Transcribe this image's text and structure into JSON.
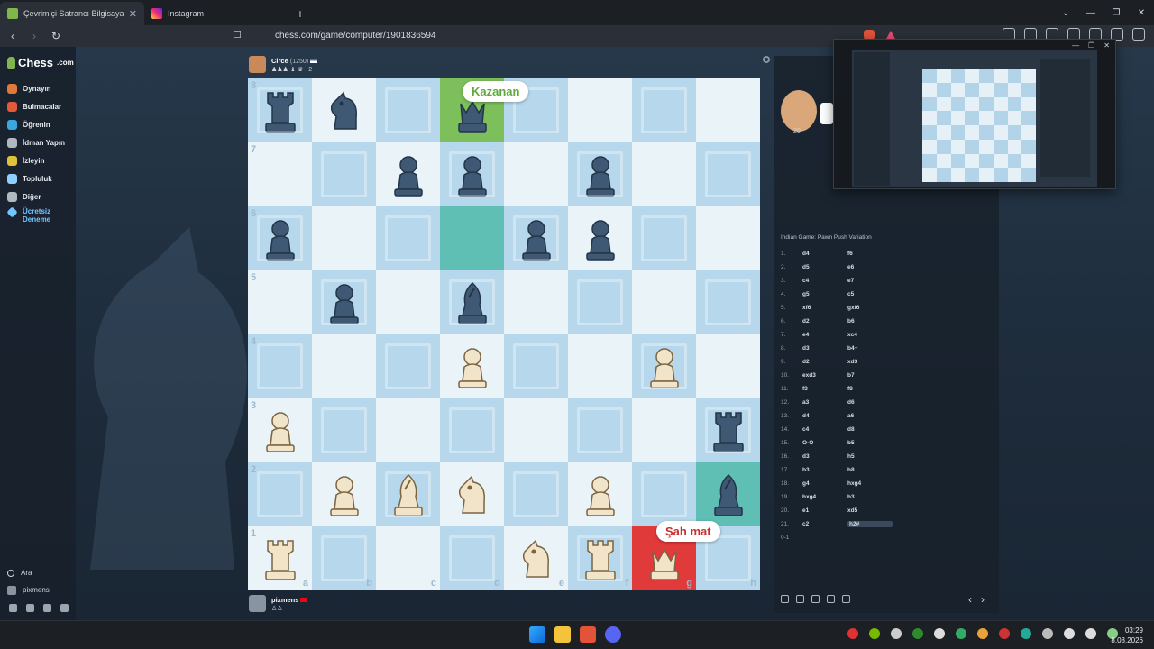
{
  "browser": {
    "tabs": [
      {
        "title": "Çevrimiçi Satrancı Bilgisayara",
        "close": "✕",
        "active": true,
        "favicon_color": "#81b64c"
      },
      {
        "title": "Instagram",
        "active": false,
        "favicon_color": "#e1306c"
      }
    ],
    "new_tab": "+",
    "window_controls": [
      "⌄",
      "—",
      "❐",
      "✕"
    ],
    "url": "chess.com/game/computer/1901836594",
    "nav": {
      "back": "‹",
      "forward": "›",
      "reload": "↻",
      "bookmark": "☐"
    }
  },
  "sidebar": {
    "logo": "Chess",
    "logo_suffix": ".com",
    "items": [
      {
        "label": "Oynayın",
        "icon": "play-icon",
        "color": "#e07a3a"
      },
      {
        "label": "Bulmacalar",
        "icon": "puzzle-icon",
        "color": "#e25a3a"
      },
      {
        "label": "Öğrenin",
        "icon": "learn-icon",
        "color": "#3aa8e0"
      },
      {
        "label": "İdman Yapın",
        "icon": "train-icon",
        "color": "#b0b8c0"
      },
      {
        "label": "İzleyin",
        "icon": "watch-icon",
        "color": "#e0c23a"
      },
      {
        "label": "Topluluk",
        "icon": "community-icon",
        "color": "#8fd0ff"
      },
      {
        "label": "Diğer",
        "icon": "more-icon",
        "color": "#b0b8c0"
      }
    ],
    "free_trial": "Ücretsiz Deneme",
    "search": "Ara",
    "user": "pixmens"
  },
  "players": {
    "top": {
      "name": "Circe",
      "rating": "(1250)",
      "captured": "♟♟♟ ♝ ♛ +2"
    },
    "bottom": {
      "name": "pixmens",
      "captured": "♙♙"
    }
  },
  "board": {
    "badges": {
      "winner": "Kazanan",
      "mate": "Şah mat"
    },
    "ranks": [
      "8",
      "7",
      "6",
      "5",
      "4",
      "3",
      "2",
      "1"
    ],
    "files": [
      "a",
      "b",
      "c",
      "d",
      "e",
      "f",
      "g",
      "h"
    ],
    "position": [
      [
        "bR",
        "bN",
        "",
        "bK",
        "",
        "",
        "",
        ""
      ],
      [
        "",
        "",
        "bP",
        "bP",
        "",
        "bP",
        "",
        ""
      ],
      [
        "bP",
        "",
        "",
        "",
        "bP",
        "bP",
        "",
        ""
      ],
      [
        "",
        "bP",
        "",
        "bB",
        "",
        "",
        "",
        ""
      ],
      [
        "",
        "",
        "",
        "wP",
        "",
        "",
        "wP",
        ""
      ],
      [
        "wP",
        "",
        "",
        "",
        "",
        "",
        "",
        "bR"
      ],
      [
        "",
        "wP",
        "wB",
        "wN",
        "",
        "wP",
        "",
        "bB"
      ],
      [
        "wR",
        "",
        "",
        "",
        "wN",
        "wR",
        "wK",
        ""
      ]
    ]
  },
  "moves_panel": {
    "opening": "Indian Game: Pawn Push Variation",
    "moves": [
      {
        "n": "1.",
        "w": "d4",
        "b": "f6"
      },
      {
        "n": "2.",
        "w": "d5",
        "b": "e6"
      },
      {
        "n": "3.",
        "w": "c4",
        "b": "e7"
      },
      {
        "n": "4.",
        "w": "g5",
        "b": "c5"
      },
      {
        "n": "5.",
        "w": "xf6",
        "b": "gxf6"
      },
      {
        "n": "6.",
        "w": "d2",
        "b": "b6"
      },
      {
        "n": "7.",
        "w": "e4",
        "b": "xc4"
      },
      {
        "n": "8.",
        "w": "d3",
        "b": "b4+"
      },
      {
        "n": "9.",
        "w": "d2",
        "b": "xd3"
      },
      {
        "n": "10.",
        "w": "exd3",
        "b": "b7"
      },
      {
        "n": "11.",
        "w": "f3",
        "b": "f8"
      },
      {
        "n": "12.",
        "w": "a3",
        "b": "d6"
      },
      {
        "n": "13.",
        "w": "d4",
        "b": "a6"
      },
      {
        "n": "14.",
        "w": "c4",
        "b": "d8"
      },
      {
        "n": "15.",
        "w": "O-O",
        "b": "b5"
      },
      {
        "n": "16.",
        "w": "d3",
        "b": "h5"
      },
      {
        "n": "17.",
        "w": "b3",
        "b": "h8"
      },
      {
        "n": "18.",
        "w": "g4",
        "b": "hxg4"
      },
      {
        "n": "19.",
        "w": "hxg4",
        "b": "h3"
      },
      {
        "n": "20.",
        "w": "e1",
        "b": "xd5"
      },
      {
        "n": "21.",
        "w": "c2",
        "b": "h2#"
      }
    ],
    "result": "0-1",
    "coach_score": "20",
    "nav_prev": "‹",
    "nav_next": "›"
  },
  "taskbar": {
    "time": "03:29",
    "date": "8.08.2026"
  }
}
